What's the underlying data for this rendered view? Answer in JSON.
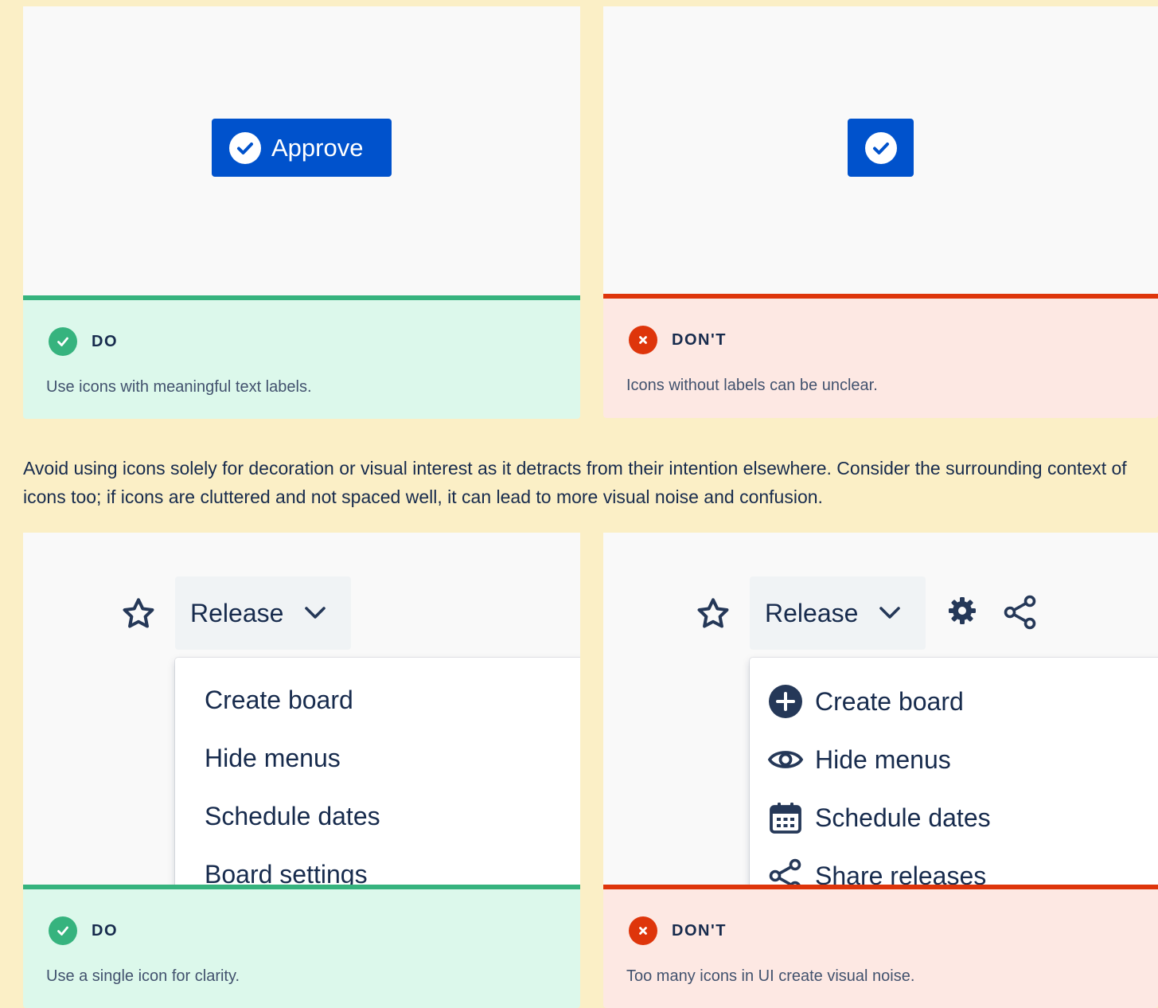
{
  "top": {
    "do": {
      "button_label": "Approve",
      "verdict_title": "DO",
      "verdict_text": "Use icons with meaningful text labels."
    },
    "dont": {
      "verdict_title": "DON'T",
      "verdict_text": "Icons without labels can be unclear."
    }
  },
  "paragraph": "Avoid using icons solely for decoration or visual interest as it detracts from their intention elsewhere. Consider the surrounding context of icons too; if icons are cluttered and not spaced well, it can lead to more visual noise and confusion.",
  "bottom": {
    "do": {
      "dropdown_label": "Release",
      "menu_items": [
        "Create board",
        "Hide menus",
        "Schedule dates",
        "Board settings"
      ],
      "verdict_title": "DO",
      "verdict_text": "Use a single icon for clarity."
    },
    "dont": {
      "dropdown_label": "Release",
      "menu_items": [
        {
          "label": "Create board",
          "icon": "add-circle-icon"
        },
        {
          "label": "Hide menus",
          "icon": "eye-icon"
        },
        {
          "label": "Schedule dates",
          "icon": "calendar-icon"
        },
        {
          "label": "Share releases",
          "icon": "share-icon"
        }
      ],
      "toolbar_icons": [
        "gear-icon",
        "share-icon"
      ],
      "verdict_title": "DON'T",
      "verdict_text": "Too many icons in UI create visual noise."
    }
  },
  "colors": {
    "page_background": "#fbefc6",
    "preview_background": "#f9f9f9",
    "primary_button": "#0052cc",
    "do_accent": "#36b37e",
    "do_background": "#dcf8eb",
    "dont_accent": "#de350b",
    "dont_background": "#fde8e3",
    "text": "#172b4d",
    "subtle_text": "#42526e"
  }
}
